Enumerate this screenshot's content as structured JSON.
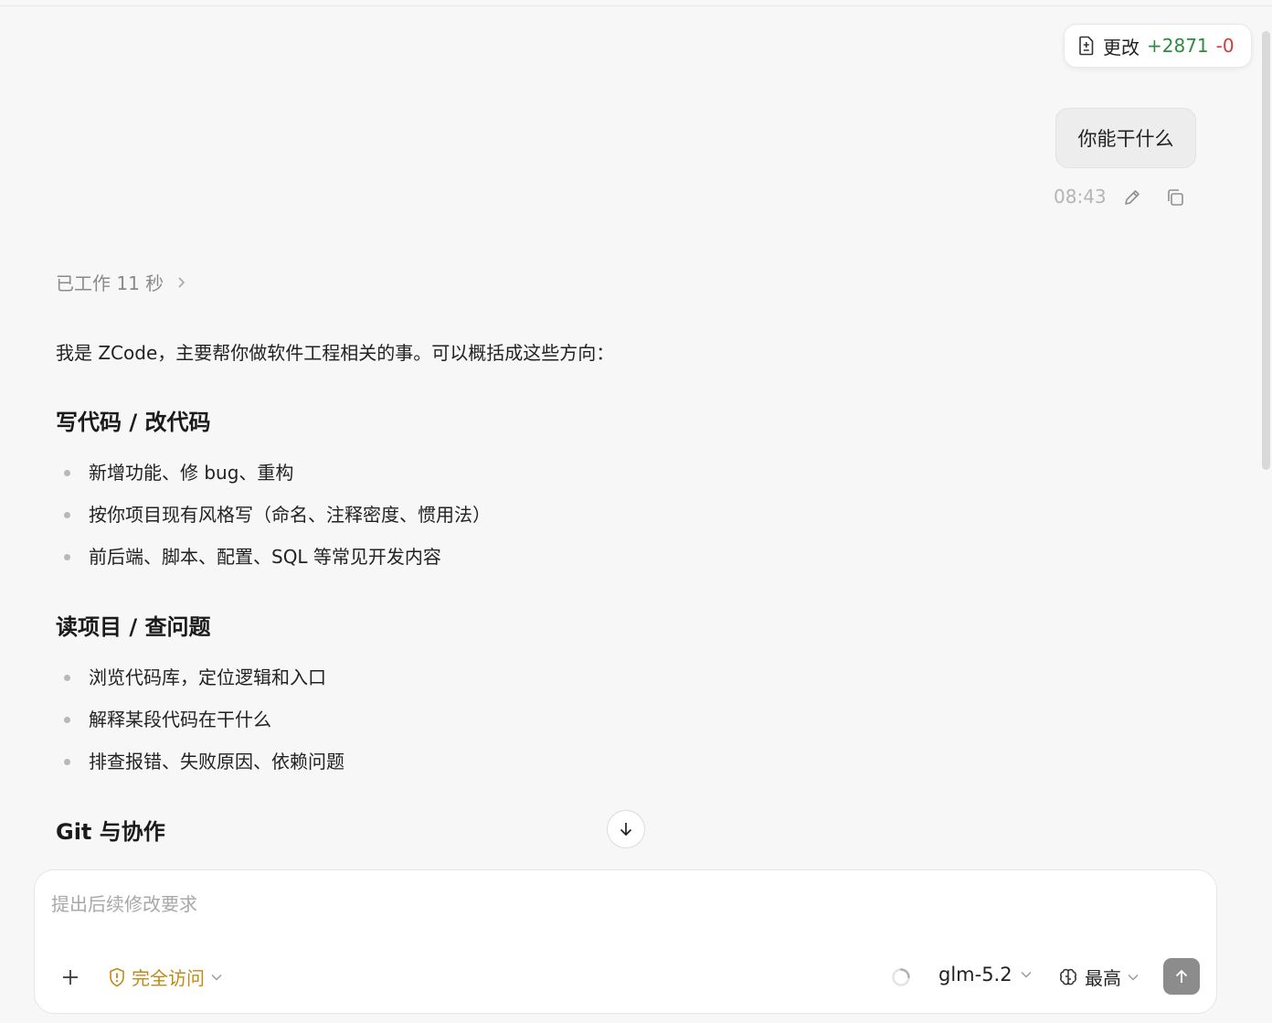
{
  "changes": {
    "label": "更改",
    "added": "+2871",
    "removed": "-0"
  },
  "user_message": {
    "text": "你能干什么",
    "time": "08:43"
  },
  "worked": {
    "label": "已工作 11 秒"
  },
  "reply": {
    "intro": "我是 ZCode，主要帮你做软件工程相关的事。可以概括成这些方向：",
    "sections": [
      {
        "title": "写代码 / 改代码",
        "items": [
          "新增功能、修 bug、重构",
          "按你项目现有风格写（命名、注释密度、惯用法）",
          "前后端、脚本、配置、SQL 等常见开发内容"
        ]
      },
      {
        "title": "读项目 / 查问题",
        "items": [
          "浏览代码库，定位逻辑和入口",
          "解释某段代码在干什么",
          "排查报错、失败原因、依赖问题"
        ]
      },
      {
        "title": "Git 与协作",
        "items": []
      }
    ]
  },
  "composer": {
    "placeholder": "提出后续修改要求",
    "value": "",
    "access_label": "完全访问",
    "model_label": "glm-5.2",
    "effort_label": "最高"
  },
  "colors": {
    "added": "#2e8a3e",
    "removed": "#d13b3b",
    "access": "#c08a16",
    "send": "#8c8c8c"
  },
  "icons": {
    "changes": "diff-file-icon",
    "edit": "pencil-icon",
    "copy": "copy-icon",
    "expand": "chevron-right-icon",
    "scroll": "arrow-down-icon",
    "add": "plus-icon",
    "access": "shield-icon",
    "dropdown": "chevron-down-icon",
    "loading": "spinner-icon",
    "effort": "brain-icon",
    "send": "arrow-up-icon"
  }
}
